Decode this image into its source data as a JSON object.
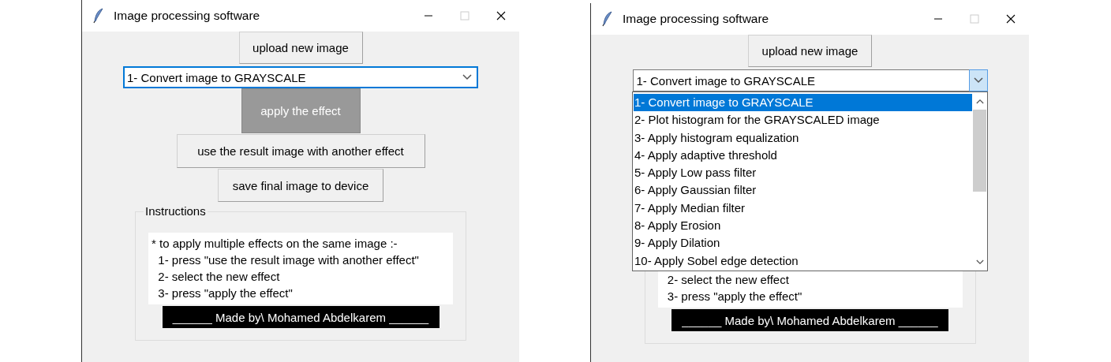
{
  "windows": [
    {
      "title": "Image processing software",
      "upload_button": "upload new image",
      "effect_select": {
        "value": "1- Convert image to GRAYSCALE",
        "focused": true,
        "open": false
      },
      "apply_button": "apply the effect",
      "reuse_button": "use the result image with another effect",
      "save_button": "save final image to device",
      "instructions": {
        "label": "Instructions",
        "lines": [
          "* to apply multiple effects on the same image :-",
          "  1- press \"use the result image with another effect\"",
          "  2- select the new effect",
          "  3- press \"apply the effect\""
        ]
      },
      "credit": "______ Made by\\ Mohamed Abdelkarem ______"
    },
    {
      "title": "Image processing software",
      "upload_button": "upload new image",
      "effect_select": {
        "value": "1- Convert image to GRAYSCALE",
        "focused": false,
        "open": true,
        "options": [
          {
            "label": "1- Convert image to GRAYSCALE",
            "selected": true
          },
          {
            "label": "2- Plot histogram for the GRAYSCALED image",
            "selected": false
          },
          {
            "label": "3- Apply histogram equalization",
            "selected": false
          },
          {
            "label": "4- Apply adaptive threshold",
            "selected": false
          },
          {
            "label": "5- Apply Low pass filter",
            "selected": false
          },
          {
            "label": "6- Apply Gaussian filter",
            "selected": false
          },
          {
            "label": "7- Apply Median filter",
            "selected": false
          },
          {
            "label": "8- Apply Erosion",
            "selected": false
          },
          {
            "label": "9- Apply Dilation",
            "selected": false
          },
          {
            "label": "10- Apply Sobel edge detection",
            "selected": false
          }
        ]
      },
      "instructions": {
        "lines": [
          "  2- select the new effect",
          "  3- press \"apply the effect\""
        ]
      },
      "credit": "______ Made by\\ Mohamed Abdelkarem ______"
    }
  ]
}
